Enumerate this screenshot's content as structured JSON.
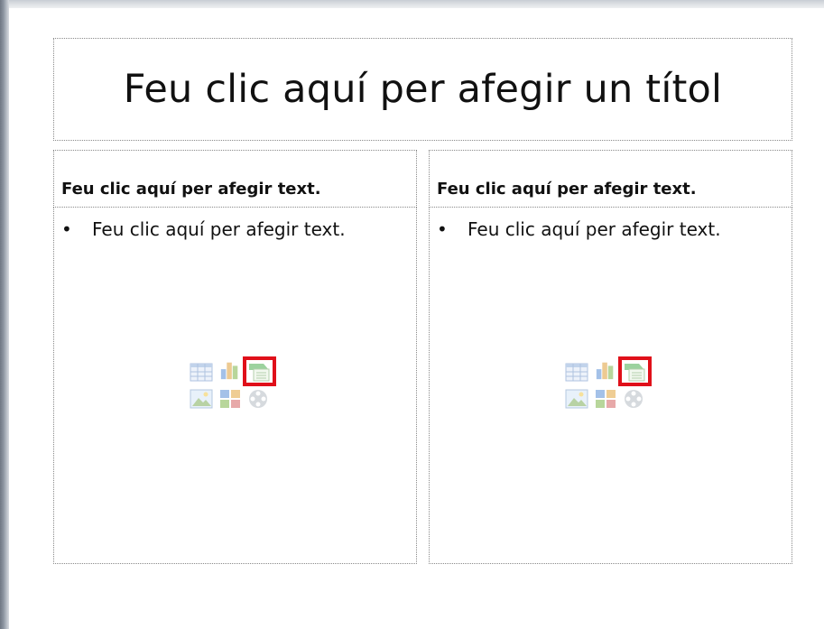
{
  "slide": {
    "title_placeholder": "Feu clic aquí per afegir un títol",
    "left_column": {
      "heading": "Feu clic aquí per afegir text.",
      "bullet": "Feu clic aquí per afegir text.",
      "bullet_symbol": "•"
    },
    "right_column": {
      "heading": "Feu clic aquí per afegir text.",
      "bullet": "Feu clic aquí per afegir text.",
      "bullet_symbol": "•"
    },
    "content_icons": [
      "insert-table-icon",
      "insert-chart-icon",
      "insert-smartart-icon",
      "insert-picture-icon",
      "insert-clipart-icon",
      "insert-media-icon"
    ],
    "highlighted_icon": "insert-smartart-icon",
    "highlight_color": "#e0101a"
  }
}
